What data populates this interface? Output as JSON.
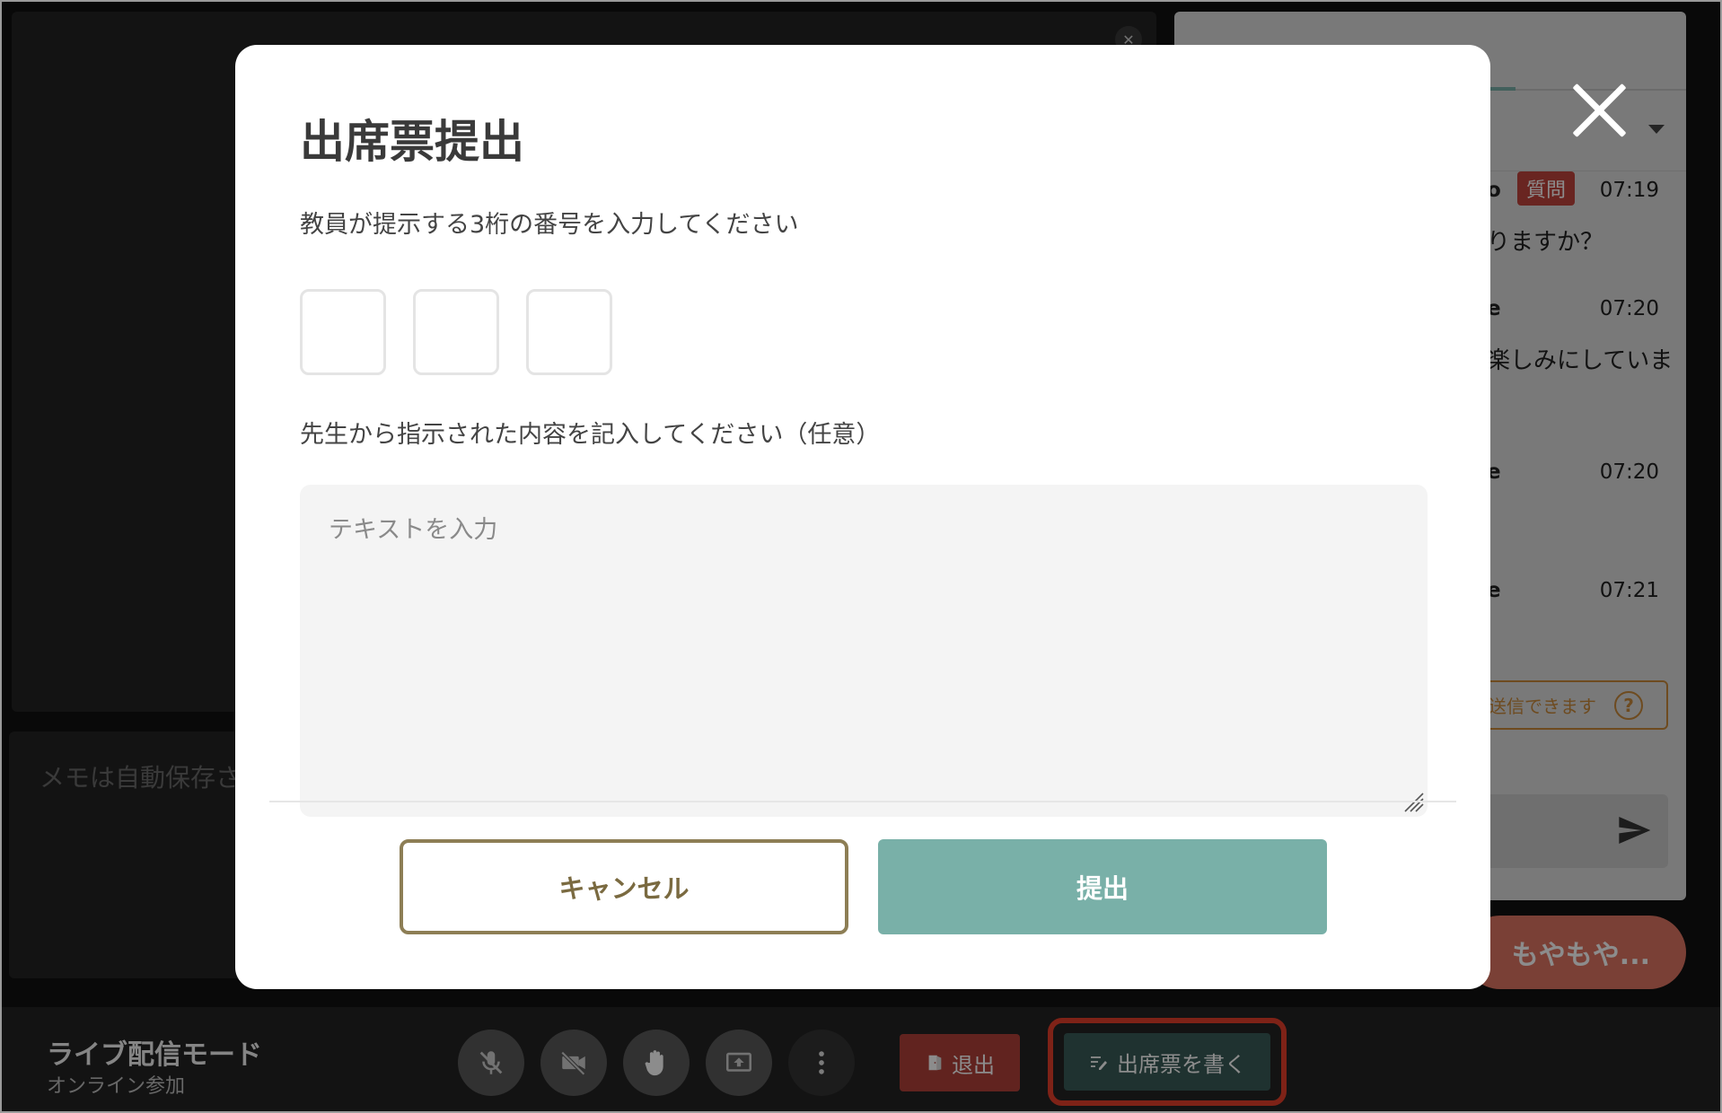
{
  "memo": {
    "placeholder": "メモは自動保存さ"
  },
  "chat": {
    "messages": [
      {
        "author_fragment": "o",
        "badge": "質問",
        "time": "07:19",
        "text_fragment": "りますか？"
      },
      {
        "author_fragment": "e",
        "time": "07:20",
        "text_fragment": "楽しみにしていま"
      },
      {
        "author_fragment": "e",
        "time": "07:20"
      },
      {
        "author_fragment": "e",
        "time": "07:21"
      }
    ],
    "notice_text": "送信できます",
    "help_symbol": "?"
  },
  "moyamoya": {
    "label": "もやもや..."
  },
  "bottom_bar": {
    "mode_title": "ライブ配信モード",
    "mode_subtitle": "オンライン参加",
    "leave_label": "退出",
    "attendance_label": "出席票を書く"
  },
  "modal": {
    "title": "出席票提出",
    "digits_label": "教員が提示する3桁の番号を入力してください",
    "digits": [
      "",
      "",
      ""
    ],
    "comment_label": "先生から指示された内容を記入してください（任意）",
    "comment_placeholder": "テキストを入力",
    "comment_value": "",
    "cancel_label": "キャンセル",
    "submit_label": "提出"
  },
  "colors": {
    "accent_teal": "#79b0a8",
    "cancel_border": "#8d7e55",
    "leave_red": "#b1413a",
    "highlight_red": "#e53f2a",
    "question_badge": "#c0443d",
    "moyamoya": "#de7563"
  },
  "icons": {
    "close": "close-icon",
    "mic_off": "mic-off-icon",
    "video_off": "video-off-icon",
    "raise_hand": "raise-hand-icon",
    "screen_share": "screen-share-icon",
    "more": "more-vertical-icon",
    "door": "door-icon",
    "edit": "edit-icon",
    "send": "send-icon",
    "help": "help-icon"
  }
}
